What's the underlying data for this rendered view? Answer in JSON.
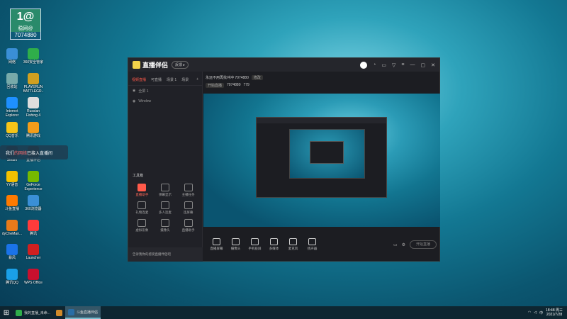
{
  "desktop": {
    "banner": {
      "big": "1@",
      "sub": "稳网@",
      "id": "7074880"
    },
    "icons": [
      {
        "label": "Administ...",
        "color": "#3a6ea5"
      },
      {
        "label": "此电脑",
        "color": "#5a9ed6"
      },
      {
        "label": "网络",
        "color": "#3a8fd6"
      },
      {
        "label": "360安全管家",
        "color": "#2fae4a"
      },
      {
        "label": "回收站",
        "color": "#7aa"
      },
      {
        "label": "PLAYERUN BATTLEGR..",
        "color": "#d0a020"
      },
      {
        "label": "Internet Explorer",
        "color": "#1e90ff"
      },
      {
        "label": "Russian Fishing 4",
        "color": "#dddddd"
      },
      {
        "label": "QQ音乐",
        "color": "#f5c518"
      },
      {
        "label": "腾讯游戏",
        "color": "#f29d1a"
      },
      {
        "label": "Steam",
        "color": "#1b2838"
      },
      {
        "label": "直播伴侣",
        "color": "#2a2a2a"
      },
      {
        "label": "YY语音",
        "color": "#f2c200"
      },
      {
        "label": "GeForce Experience",
        "color": "#76b900"
      },
      {
        "label": "斗鱼直播",
        "color": "#ff7a00"
      },
      {
        "label": "360浏览器",
        "color": "#3a8fd6"
      },
      {
        "label": "dyCheMan...",
        "color": "#e87a1a"
      },
      {
        "label": "腾讯",
        "color": "#ff3b3b"
      },
      {
        "label": "暴风",
        "color": "#1a73e8"
      },
      {
        "label": "Launcher",
        "color": "#d02020"
      },
      {
        "label": "腾讯QQ",
        "color": "#1aa0e8"
      },
      {
        "label": "WPS Office",
        "color": "#c8102e"
      }
    ],
    "toast": {
      "pre": "我们",
      "red": "的网络",
      "post": "已接入直播间"
    }
  },
  "app": {
    "name": "直播伴侣",
    "pill": "反馈 ▸",
    "title_icons": [
      "bell-icon",
      "shop-icon",
      "gift-icon",
      "menu-icon"
    ],
    "window_controls": [
      "minimize",
      "maximize",
      "close"
    ],
    "scene_tabs": [
      "视频直播",
      "可直播",
      "场景 1",
      "场景"
    ],
    "sources": [
      {
        "label": "全屏 1"
      },
      {
        "label": "Window"
      }
    ],
    "tools_title": "工具箱",
    "tools": [
      {
        "label": "直播助手",
        "red": true
      },
      {
        "label": "弹幕显示",
        "red": false
      },
      {
        "label": "主播任务",
        "red": false
      },
      {
        "label": "礼物连麦",
        "red": false
      },
      {
        "label": "多人连麦",
        "red": false
      },
      {
        "label": "连屏幕",
        "red": false
      },
      {
        "label": "虚拟形象",
        "red": false
      },
      {
        "label": "摄像头",
        "red": false
      },
      {
        "label": "直播助手",
        "red": false
      },
      {
        "label": "弹幕灯",
        "red": false
      },
      {
        "label": "动态",
        "red": false
      },
      {
        "label": "更多",
        "red": false
      }
    ],
    "bottom_note": "告诉我你的感受直播伴侣吧",
    "room_title": "永远不用再找冲冲 7074880",
    "room_tag": "修改",
    "sub_info": {
      "tag": "开始直播",
      "id": "7074880",
      "likes": "779"
    },
    "header_icons": [
      "settings-icon",
      "lock-icon",
      "layout-icon",
      "bell-icon",
      "share-icon"
    ],
    "controls": [
      {
        "label": "直播屏幕",
        "icon": "monitor-icon"
      },
      {
        "label": "摄像头",
        "icon": "camera-icon"
      },
      {
        "label": "手机投屏",
        "icon": "phone-icon"
      },
      {
        "label": "多媒体",
        "icon": "media-icon"
      },
      {
        "label": "麦克风",
        "icon": "mic-icon"
      },
      {
        "label": "扬声器",
        "icon": "speaker-icon"
      }
    ],
    "go_live": "开始直播",
    "status": {
      "cpu": "CPU 2%",
      "fps": "FPS 60"
    }
  },
  "taskbar": {
    "tasks": [
      {
        "label": "我的直播_未命...",
        "color": "#2fae4a",
        "active": false
      },
      {
        "label": "",
        "color": "#d08a2a",
        "active": false
      },
      {
        "label": "斗鱼直播伴侣",
        "color": "#2a6ea5",
        "active": true
      }
    ],
    "time": "18:48 周三",
    "date": "2021/7/28"
  }
}
